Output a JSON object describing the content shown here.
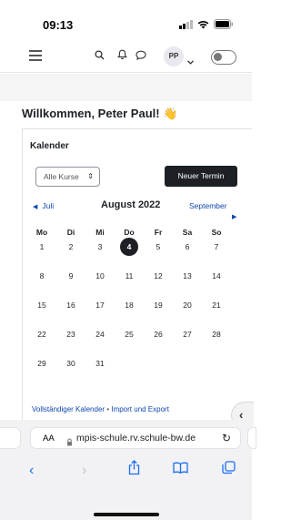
{
  "status_bar": {
    "time": "09:13",
    "icons": [
      "signal-icon",
      "wifi-icon",
      "battery-icon"
    ]
  },
  "navbar": {
    "icons": [
      "menu-icon",
      "search-icon",
      "bell-icon",
      "chat-icon",
      "chevron-down-icon"
    ],
    "avatar_initials": "PP"
  },
  "welcome": {
    "text": "Willkommen, Peter Paul!",
    "emoji": "👋"
  },
  "calendar": {
    "title": "Kalender",
    "course_select": {
      "value": "Alle Kurse",
      "caret": "⇕"
    },
    "new_event_label": "Neuer Termin",
    "prev_month": "Juli",
    "current_month": "August 2022",
    "next_month": "September",
    "weekdays": [
      "Mo",
      "Di",
      "Mi",
      "Do",
      "Fr",
      "Sa",
      "So"
    ],
    "weeks": [
      [
        "1",
        "2",
        "3",
        "4",
        "5",
        "6",
        "7"
      ],
      [
        "8",
        "9",
        "10",
        "11",
        "12",
        "13",
        "14"
      ],
      [
        "15",
        "16",
        "17",
        "18",
        "19",
        "20",
        "21"
      ],
      [
        "22",
        "23",
        "24",
        "25",
        "26",
        "27",
        "28"
      ],
      [
        "29",
        "30",
        "31",
        "",
        "",
        "",
        ""
      ]
    ],
    "today": "4",
    "footer": {
      "full_calendar": "Vollständiger Kalender",
      "separator": "•",
      "import_export": "Import und Export"
    }
  },
  "drawer_toggle": {
    "chevron": "‹"
  },
  "browser": {
    "aa_label": "AA",
    "url": "mpis-schule.rv.schule-bw.de",
    "reload_glyph": "↻",
    "toolbar": {
      "back": "‹",
      "forward": "›"
    }
  },
  "colors": {
    "link": "#0f47ad",
    "primary_button": "#1d2125",
    "safari_accent": "#1b6ef3"
  }
}
